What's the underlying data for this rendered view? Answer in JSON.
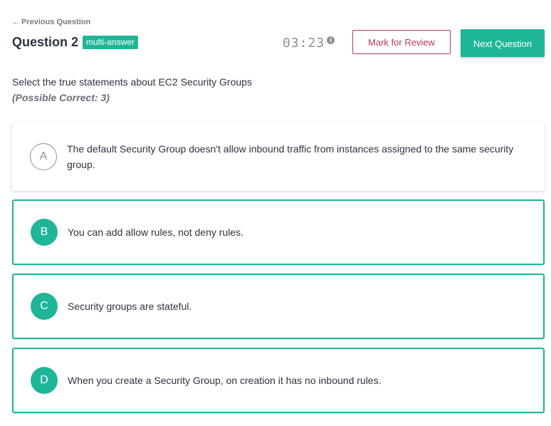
{
  "nav": {
    "previous_label": "Previous Question"
  },
  "question": {
    "title": "Question 2",
    "badge": "multi-answer",
    "timer": "03:23",
    "prompt": "Select the true statements about EC2 Security Groups",
    "possible_correct": "(Possible Correct: 3)"
  },
  "buttons": {
    "review_label": "Mark for Review",
    "next_label": "Next Question"
  },
  "options": [
    {
      "letter": "A",
      "text": "The default Security Group doesn't allow inbound traffic from instances assigned to the same security group.",
      "selected": false
    },
    {
      "letter": "B",
      "text": "You can add allow rules, not deny rules.",
      "selected": true
    },
    {
      "letter": "C",
      "text": "Security groups are stateful.",
      "selected": true
    },
    {
      "letter": "D",
      "text": "When you create a Security Group, on creation it has no inbound rules.",
      "selected": true
    }
  ],
  "colors": {
    "accent": "#1fb597",
    "review": "#b53a64",
    "muted": "#8c9198",
    "text": "#2c3440"
  },
  "icons": {
    "back": "arrow-left-icon",
    "timer_info": "info-icon"
  }
}
